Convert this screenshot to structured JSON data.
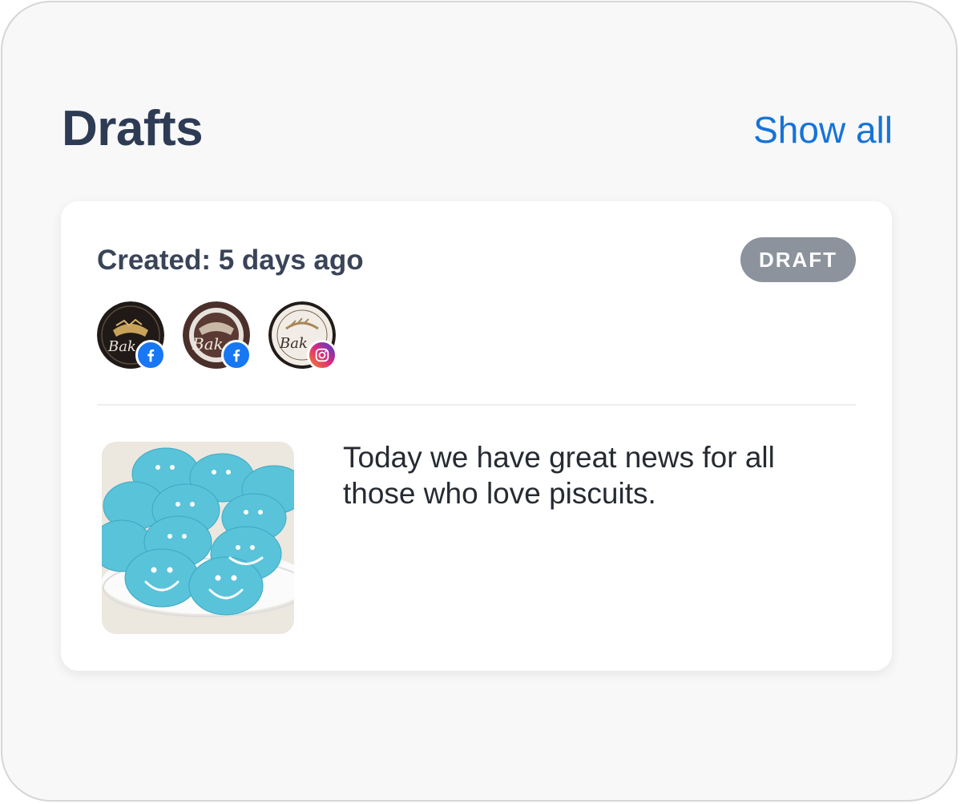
{
  "header": {
    "title": "Drafts",
    "show_all_label": "Show all"
  },
  "draft": {
    "created_label": "Created: 5 days ago",
    "status_badge": "DRAFT",
    "accounts": [
      {
        "avatar": "bakery-logo-icon",
        "network": "facebook-icon"
      },
      {
        "avatar": "bakery-logo-icon",
        "network": "facebook-icon"
      },
      {
        "avatar": "bakery-logo-icon",
        "network": "instagram-icon"
      }
    ],
    "image": "blue-smiley-cookies-photo",
    "text": "Today we have great news for all those who love piscuits."
  },
  "colors": {
    "title": "#2e3b55",
    "link": "#1673d8",
    "badge_bg": "#8c939c",
    "facebook": "#1877f2"
  }
}
